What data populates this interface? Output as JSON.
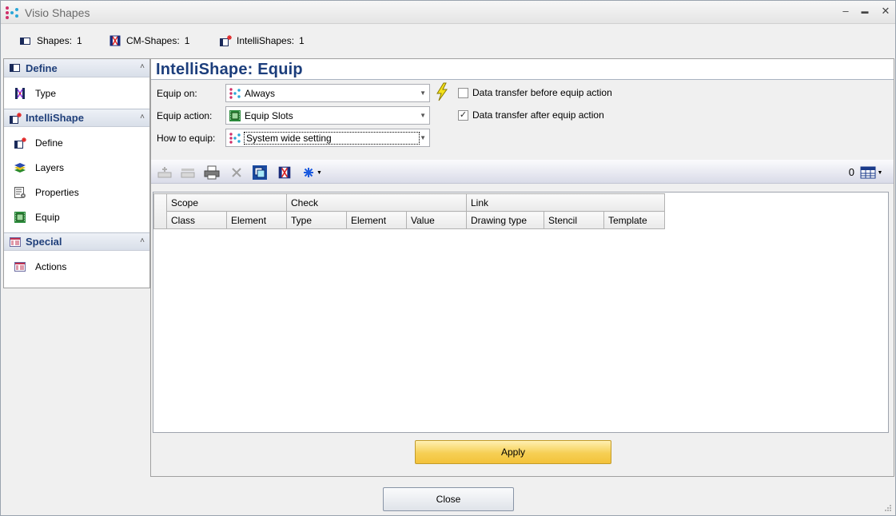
{
  "window": {
    "title": "Visio Shapes",
    "minimize_glyph": "–",
    "maximize_glyph": "▬",
    "close_glyph": "✕"
  },
  "counters": [
    {
      "label": "Shapes:",
      "value": "1",
      "icon": "shape-icon"
    },
    {
      "label": "CM-Shapes:",
      "value": "1",
      "icon": "cm-shapes-icon"
    },
    {
      "label": "IntelliShapes:",
      "value": "1",
      "icon": "intellishape-icon"
    }
  ],
  "sidebar": {
    "groups": [
      {
        "label": "Define",
        "icon": "define-icon",
        "items": [
          {
            "label": "Type",
            "icon": "type-icon"
          }
        ]
      },
      {
        "label": "IntelliShape",
        "icon": "intellishape-icon",
        "items": [
          {
            "label": "Define",
            "icon": "define-intellishape-icon"
          },
          {
            "label": "Layers",
            "icon": "layers-icon"
          },
          {
            "label": "Properties",
            "icon": "properties-icon"
          },
          {
            "label": "Equip",
            "icon": "equip-icon"
          }
        ]
      },
      {
        "label": "Special",
        "icon": "special-icon",
        "items": [
          {
            "label": "Actions",
            "icon": "actions-icon"
          }
        ]
      }
    ],
    "collapse_glyph": "˄"
  },
  "main": {
    "heading": "IntelliShape:  Equip",
    "form": {
      "equip_on_label": "Equip on:",
      "equip_on_value": "Always",
      "equip_action_label": "Equip action:",
      "equip_action_value": "Equip Slots",
      "how_to_equip_label": "How to equip:",
      "how_to_equip_value": "System wide setting",
      "checkbox_before_label": "Data transfer before equip action",
      "checkbox_before_checked": false,
      "checkbox_after_label": "Data transfer after equip action",
      "checkbox_after_checked": true
    },
    "toolbar": {
      "count": "0"
    },
    "grid": {
      "group_headers": [
        "Scope",
        "Check",
        "Link"
      ],
      "columns": [
        "Class",
        "Element",
        "Type",
        "Element",
        "Value",
        "Drawing type",
        "Stencil",
        "Template"
      ],
      "rows": []
    },
    "apply_label": "Apply"
  },
  "footer": {
    "close_label": "Close"
  },
  "colors": {
    "heading": "#1c3e7c",
    "group_label": "#1f3f7a",
    "apply_button": "#f6cf54"
  }
}
